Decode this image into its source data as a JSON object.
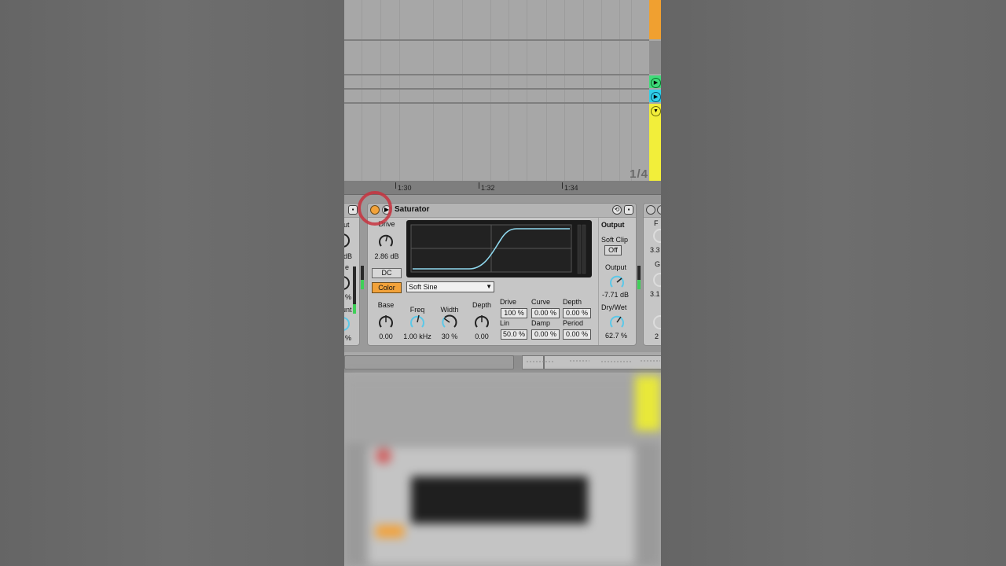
{
  "arrangement": {
    "page_indicator": "1/4",
    "ruler_ticks": [
      "1:30",
      "1:32",
      "1:34"
    ]
  },
  "device": {
    "title": "Saturator",
    "drive": {
      "label": "Drive",
      "value": "2.86 dB"
    },
    "dc_label": "DC",
    "color_label": "Color",
    "shape": "Soft Sine",
    "base": {
      "label": "Base",
      "value": "0.00"
    },
    "freq": {
      "label": "Freq",
      "value": "1.00 kHz"
    },
    "width": {
      "label": "Width",
      "value": "30 %"
    },
    "depth": {
      "label": "Depth",
      "value": "0.00"
    },
    "waveshaper": {
      "drive_label": "Drive",
      "drive_value": "100 %",
      "curve_label": "Curve",
      "curve_value": "0.00 %",
      "depth_label": "Depth",
      "depth_value": "0.00 %",
      "lin_label": "Lin",
      "lin_value": "50.0 %",
      "damp_label": "Damp",
      "damp_value": "0.00 %",
      "period_label": "Period",
      "period_value": "0.00 %"
    },
    "output": {
      "heading": "Output",
      "soft_clip_label": "Soft Clip",
      "soft_clip_value": "Off",
      "output_label": "Output",
      "output_value": "-7.71 dB",
      "drywet_label": "Dry/Wet",
      "drywet_value": "62.7 %"
    }
  },
  "neighbor_left": {
    "labels": [
      "ut",
      "dB",
      "e",
      "%",
      "unt",
      "%"
    ]
  },
  "neighbor_right": {
    "labels": [
      "F",
      "3.3",
      "G",
      "3.1",
      "2"
    ]
  },
  "colors": {
    "accent": "#f2a23a",
    "knob_arc": "#5bc8e8",
    "meter": "#3fcf58",
    "clip_orange": "#f0a030",
    "clip_green": "#3fdc7a",
    "clip_cyan": "#2fd0e8",
    "clip_yellow": "#f2ee3a",
    "highlight": "#c8323e"
  }
}
